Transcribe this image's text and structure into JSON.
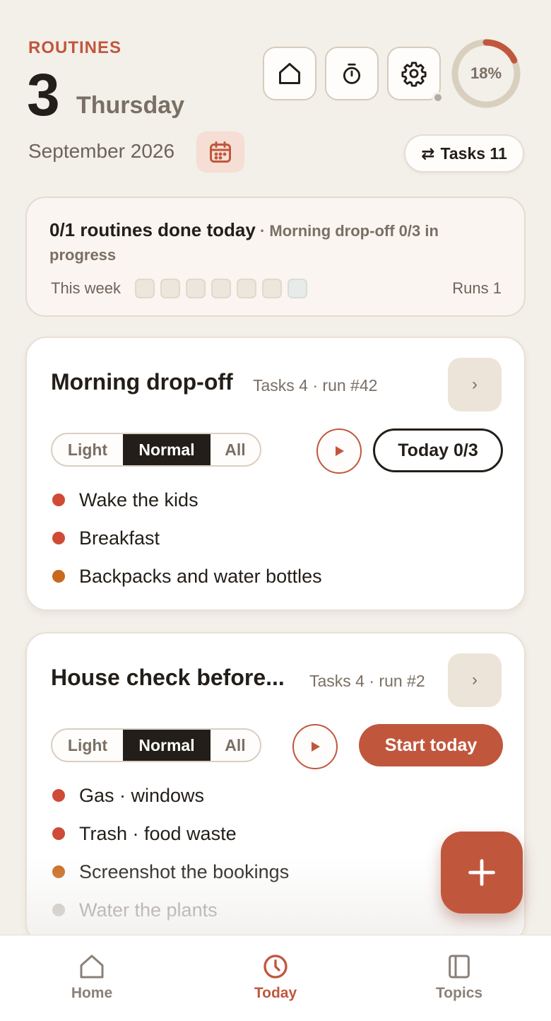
{
  "header": {
    "eyebrow": "ROUTINES",
    "day_number": "3",
    "weekday": "Thursday",
    "month_year": "September 2026",
    "progress_label": "18%",
    "progress_fraction": 0.18,
    "tasks_chip": "Tasks 11",
    "tasks_chip_icon": "⇄"
  },
  "summary": {
    "main": "0/1 routines done today",
    "detail": " · Morning drop-off 0/3 in progress",
    "week_label": "This week",
    "week_days_count": 7,
    "runs": "Runs 1"
  },
  "routines": [
    {
      "title": "Morning drop-off",
      "meta": "Tasks 4 · run #42",
      "modes": [
        "Light",
        "Normal",
        "All"
      ],
      "selected_mode": "Normal",
      "action_label": "Today 0/3",
      "tasks": [
        {
          "label": "Wake the kids",
          "priority": "red"
        },
        {
          "label": "Breakfast",
          "priority": "red"
        },
        {
          "label": "Backpacks and water bottles",
          "priority": "orange"
        }
      ]
    },
    {
      "title": "House check before...",
      "meta": "Tasks 4 · run #2",
      "modes": [
        "Light",
        "Normal",
        "All"
      ],
      "selected_mode": "Normal",
      "action_label": "Start today",
      "tasks": [
        {
          "label": "Gas · windows",
          "priority": "red"
        },
        {
          "label": "Trash · food waste",
          "priority": "red"
        },
        {
          "label": "Screenshot the bookings",
          "priority": "orange"
        },
        {
          "label": "Water the plants",
          "priority": "grey"
        }
      ]
    }
  ],
  "nav": {
    "home": "Home",
    "today": "Today",
    "topics": "Topics"
  },
  "colors": {
    "accent": "#c0573d",
    "background": "#f3efe9",
    "text": "#231e19",
    "muted": "#7a6f64",
    "priority_red": "#cf4b36",
    "priority_orange": "#c8691e",
    "priority_grey": "#c4bfba"
  },
  "icons": {
    "home_button": "home-icon",
    "timer_button": "stopwatch-icon",
    "settings_button": "gear-icon",
    "calendar_button": "calendar-icon",
    "play": "play-icon",
    "chevron": "chevron-right-icon",
    "fab": "plus-icon",
    "nav_today": "clock-icon",
    "nav_topics": "book-icon"
  }
}
